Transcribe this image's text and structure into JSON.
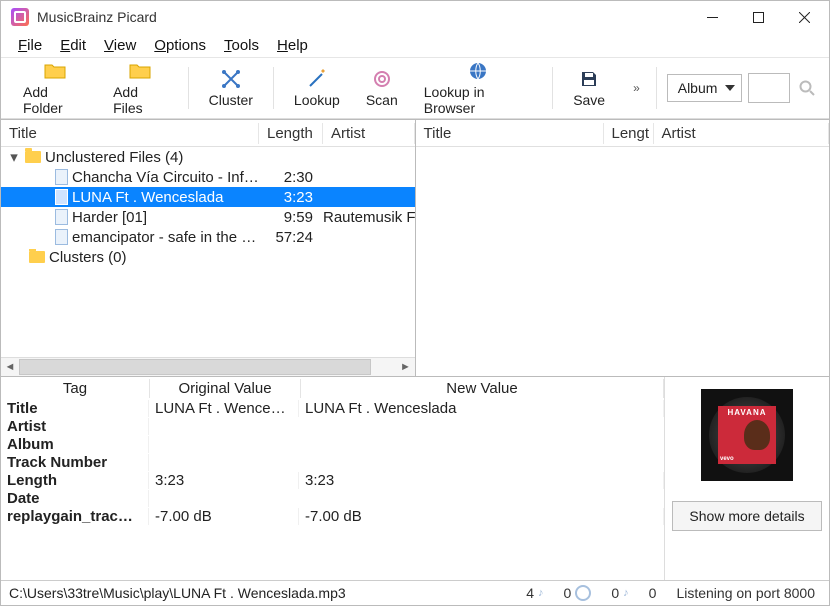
{
  "window": {
    "title": "MusicBrainz Picard"
  },
  "menu": {
    "file": "File",
    "edit": "Edit",
    "view": "View",
    "options": "Options",
    "tools": "Tools",
    "help": "Help",
    "file_u": "F",
    "edit_u": "E",
    "view_u": "V",
    "options_u": "O",
    "tools_u": "T",
    "help_u": "H"
  },
  "toolbar": {
    "add_folder": "Add Folder",
    "add_files": "Add Files",
    "cluster": "Cluster",
    "lookup": "Lookup",
    "scan": "Scan",
    "lookup_browser": "Lookup in Browser",
    "save": "Save",
    "combo_value": "Album"
  },
  "columns": {
    "title": "Title",
    "length": "Length",
    "artist": "Artist",
    "length_short": "Lengt"
  },
  "left_tree": {
    "group0": {
      "label": "Unclustered Files (4)"
    },
    "rows": [
      {
        "title": "Chancha Vía Circuito - Inf…",
        "length": "2:30",
        "artist": ""
      },
      {
        "title": "LUNA Ft . Wenceslada",
        "length": "3:23",
        "artist": ""
      },
      {
        "title": "Harder [01]",
        "length": "9:59",
        "artist": "Rautemusik F"
      },
      {
        "title": "emancipator - safe in the …",
        "length": "57:24",
        "artist": ""
      }
    ],
    "group1": {
      "label": "Clusters (0)"
    }
  },
  "metadata": {
    "headers": {
      "tag": "Tag",
      "original": "Original Value",
      "new": "New Value"
    },
    "rows": [
      {
        "tag": "Title",
        "ov": "LUNA Ft . Wencesl…",
        "nv": "LUNA Ft . Wenceslada"
      },
      {
        "tag": "Artist",
        "ov": "",
        "nv": ""
      },
      {
        "tag": "Album",
        "ov": "",
        "nv": ""
      },
      {
        "tag": "Track Number",
        "ov": "",
        "nv": ""
      },
      {
        "tag": "Length",
        "ov": "3:23",
        "nv": "3:23"
      },
      {
        "tag": "Date",
        "ov": "",
        "nv": ""
      },
      {
        "tag": "replaygain_trac…",
        "ov": "-7.00 dB",
        "nv": "-7.00 dB"
      }
    ],
    "details_button": "Show more details",
    "cover_title": "HAVANA",
    "cover_badge": "vevo"
  },
  "status": {
    "path": "C:\\Users\\33tre\\Music\\play\\LUNA Ft . Wenceslada.mp3",
    "files": "4",
    "albums": "0",
    "pending_files": "0",
    "pending_requests": "0",
    "listening": "Listening on port 8000"
  }
}
